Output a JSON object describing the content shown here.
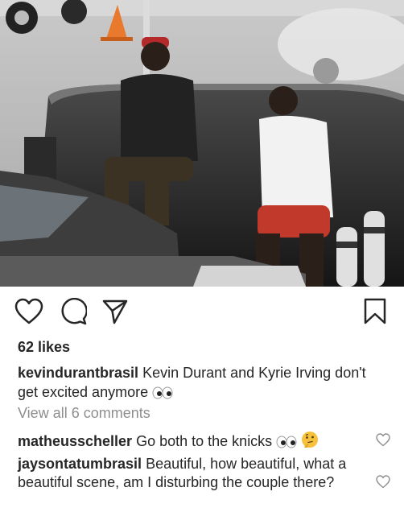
{
  "post": {
    "image_alt": "Two men sitting on a black marble ledge outside a building, a car parked in front",
    "likes": "62 likes"
  },
  "actions": {
    "like_icon": "heart-outline-icon",
    "comment_icon": "speech-bubble-icon",
    "share_icon": "paper-plane-icon",
    "save_icon": "bookmark-icon"
  },
  "caption": {
    "username": "kevindurantbrasil",
    "text": "Kevin Durant and Kyrie Irving don't get excited anymore",
    "emoji": "eyes-emoji"
  },
  "view_all": "View all 6 comments",
  "comments": [
    {
      "username": "matheusscheller",
      "text": "Go both to the knicks",
      "emoji": [
        "eyes-emoji",
        "thinking-face-emoji"
      ]
    },
    {
      "username": "jaysontatumbrasil",
      "text": "Beautiful, how beautiful, what a beautiful scene, am I disturbing the couple there?"
    }
  ]
}
